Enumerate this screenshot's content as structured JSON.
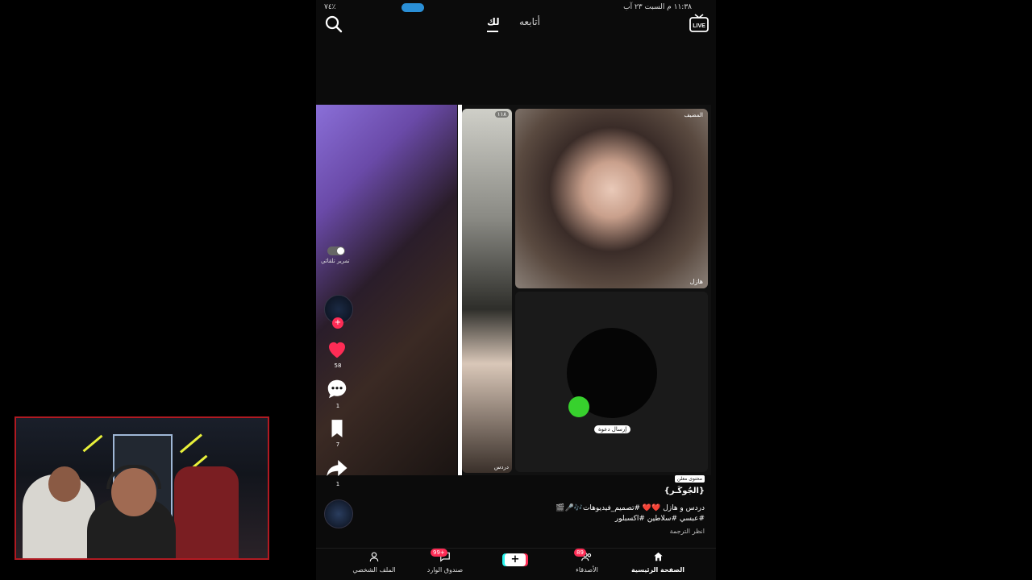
{
  "status_bar": {
    "time": "١١:٣٨ م  السبت ٢٣ آب",
    "icons_text": "٧٤٪"
  },
  "top_nav": {
    "tab_for_you": "لك",
    "tab_following": "أتابعه"
  },
  "video": {
    "autoscroll_label": "تمرير تلقائي",
    "guest_tile_badge": "١١٨",
    "guest_tile_name": "دردس",
    "host_tag": "المضيف",
    "host_name": "هازل",
    "invite_label": "إرسال دعوة"
  },
  "action_rail": {
    "like_count": "58",
    "comment_count": "1",
    "save_count": "7",
    "share_count": "1"
  },
  "caption": {
    "sponsor_badge": "محتوى معلن",
    "username": "{الجُوكَـر}",
    "line1": "دردس و هازل ❤️❤️ #تصميم_فيديوهات🎶🎤🎬",
    "line2": "#عبسي #سلاطين #اكسبلور",
    "see_translation": "انظر الترجمة"
  },
  "bottom_nav": {
    "home": "الصفحة الرئيسية",
    "friends": "الأصدقاء",
    "friends_badge": "89",
    "create": "+",
    "inbox": "صندوق الوارد",
    "inbox_badge": "99+",
    "profile": "الملف الشخصي"
  },
  "colors": {
    "accent_red": "#fe2c55",
    "accent_cyan": "#25f4ee",
    "live_indicator": "#37d12d"
  }
}
